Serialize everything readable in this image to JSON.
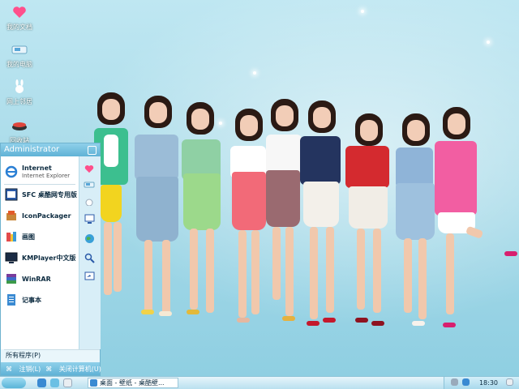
{
  "desktop": {
    "icons": [
      {
        "label": "我的文档",
        "icon": "heart-icon"
      },
      {
        "label": "我的电脑",
        "icon": "computer-icon"
      },
      {
        "label": "网上邻居",
        "icon": "bunny-icon"
      },
      {
        "label": "回收站",
        "icon": "recycle-bin-icon"
      }
    ]
  },
  "start_menu": {
    "user": "Administrator",
    "items": [
      {
        "label": "Internet",
        "sub": "Internet Explorer",
        "icon": "ie-icon"
      },
      {
        "label": "SFC 桌酷网专用版",
        "icon": "sfc-icon"
      },
      {
        "label": "IconPackager",
        "icon": "iconpackager-icon"
      },
      {
        "label": "画图",
        "icon": "paint-icon"
      },
      {
        "label": "KMPlayer中文版",
        "icon": "kmplayer-icon"
      },
      {
        "label": "WinRAR",
        "icon": "winrar-icon"
      },
      {
        "label": "记事本",
        "icon": "notepad-icon"
      }
    ],
    "right_icons": [
      "heart-icon",
      "network-icon",
      "drop-icon",
      "monitor-icon",
      "globe-icon",
      "search-icon",
      "run-icon"
    ],
    "all_programs": "所有程序(P)",
    "logoff": "注销(L)",
    "shutdown": "关闭计算机(U)"
  },
  "taskbar": {
    "task_label": "桌面 - 壁纸 - 桌酷壁...",
    "clock": "18:30"
  },
  "colors": {
    "accent": "#5fb2d6",
    "desktop_bg": "#a9dbe9"
  }
}
